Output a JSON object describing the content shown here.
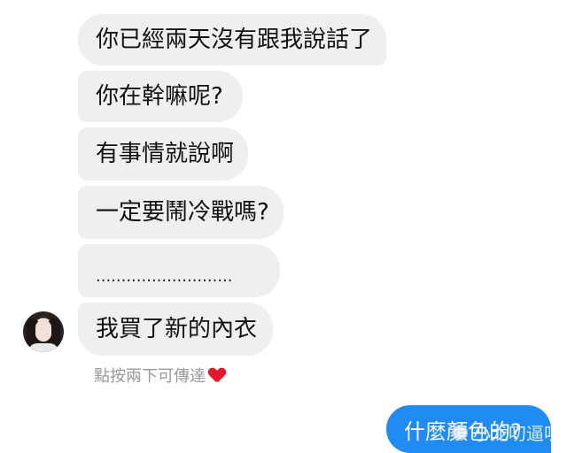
{
  "messages": [
    {
      "text": "你已經兩天沒有跟我說話了"
    },
    {
      "text": "你在幹嘛呢?"
    },
    {
      "text": "有事情就說啊"
    },
    {
      "text": "一定要鬧冷戰嗎?"
    },
    {
      "text": "..........................."
    },
    {
      "text": "我買了新的內衣"
    }
  ],
  "hint": "點按兩下可傳達",
  "sent_message": "什麼顏色的?",
  "watermark": "小龙叨逼叨",
  "colors": {
    "received_bubble": "#efeff1",
    "sent_bubble": "#1f8bf3",
    "hint_text": "#9a9a9a",
    "heart": "#e2192b"
  },
  "icons": {
    "avatar": "profile-avatar",
    "reaction": "heart-icon"
  }
}
